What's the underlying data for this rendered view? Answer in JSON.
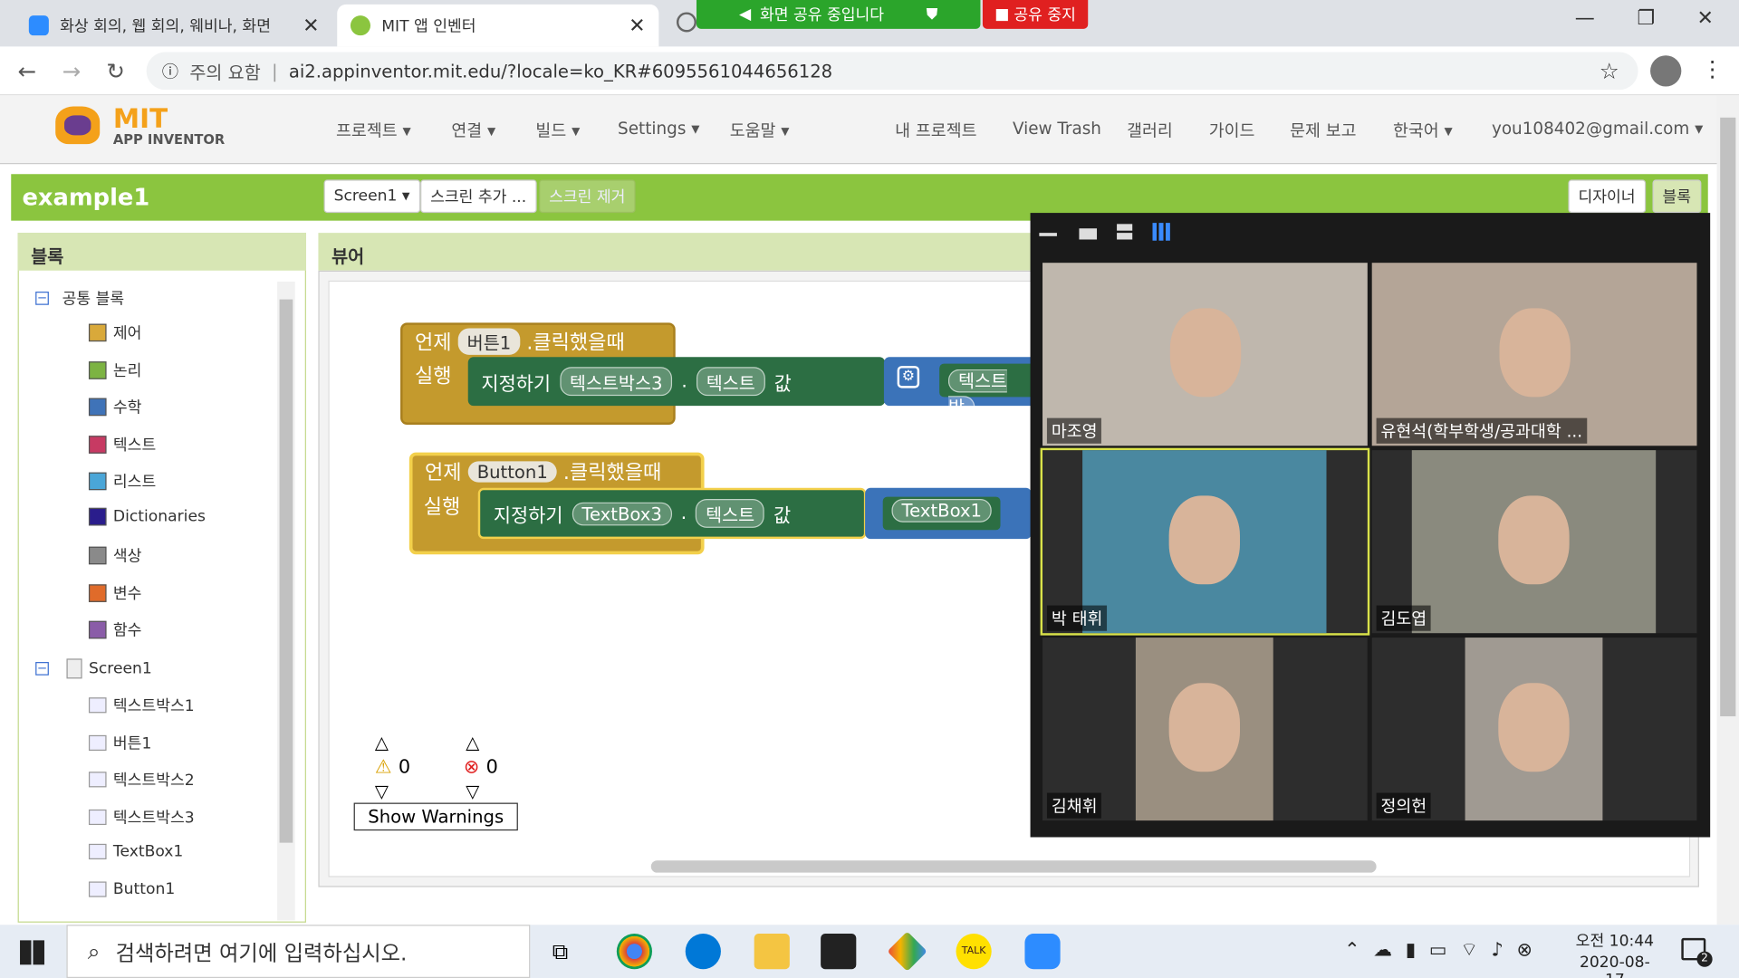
{
  "browser": {
    "tabs": [
      {
        "title": "화상 회의, 웹 회의, 웨비나, 화면"
      },
      {
        "title": "MIT 앱 인벤터"
      }
    ],
    "share_banner": "화면 공유 중입니다",
    "stop_share": "공유 중지",
    "address": {
      "security": "주의 요함",
      "url": "ai2.appinventor.mit.edu/?locale=ko_KR#6095561044656128"
    }
  },
  "app": {
    "logo_main": "MIT",
    "logo_sub": "APP INVENTOR",
    "menus": [
      "프로젝트 ▾",
      "연결 ▾",
      "빌드 ▾",
      "Settings ▾",
      "도움말 ▾"
    ],
    "right_links": [
      "내 프로젝트",
      "View Trash",
      "갤러리",
      "가이드",
      "문제 보고",
      "한국어 ▾",
      "you108402@gmail.com ▾"
    ],
    "project_name": "example1",
    "screen_select": "Screen1 ▾",
    "add_screen": "스크린 추가 ...",
    "remove_screen": "스크린 제거",
    "designer": "디자이너",
    "blocks_btn": "블록"
  },
  "blocks_panel": {
    "title": "블록",
    "builtin": "공통 블록",
    "categories": [
      {
        "label": "제어",
        "color": "#d9a93a"
      },
      {
        "label": "논리",
        "color": "#7cb342"
      },
      {
        "label": "수학",
        "color": "#3f73b8"
      },
      {
        "label": "텍스트",
        "color": "#c73a63"
      },
      {
        "label": "리스트",
        "color": "#4aa6d8"
      },
      {
        "label": "Dictionaries",
        "color": "#2a1d8c"
      },
      {
        "label": "색상",
        "color": "#8a8a8a"
      },
      {
        "label": "변수",
        "color": "#e06b2a"
      },
      {
        "label": "함수",
        "color": "#8a5ca8"
      }
    ],
    "screen": "Screen1",
    "components": [
      "텍스트박스1",
      "버튼1",
      "텍스트박스2",
      "텍스트박스3",
      "TextBox1",
      "Button1"
    ]
  },
  "viewer": {
    "title": "뷰어",
    "block1": {
      "when": "언제",
      "component": "버튼1",
      "event": ".클릭했을때",
      "do": "실행",
      "set": "지정하기",
      "target": "텍스트박스3",
      "dot": ".",
      "prop": "텍스트",
      "to": "값",
      "value": "텍스트박"
    },
    "block2": {
      "when": "언제",
      "component": "Button1",
      "event": ".클릭했을때",
      "do": "실행",
      "set": "지정하기",
      "target": "TextBox3",
      "dot": ".",
      "prop": "텍스트",
      "to": "값",
      "value": "TextBox1"
    },
    "warnings_count": "0",
    "errors_count": "0",
    "show_warnings": "Show Warnings"
  },
  "zoom": {
    "participants": [
      "마조영",
      "유현석(학부학생/공과대학 ...",
      "박 태휘",
      "김도엽",
      "김채휘",
      "정의헌"
    ]
  },
  "taskbar": {
    "search_placeholder": "검색하려면 여기에 입력하십시오.",
    "time": "오전 10:44",
    "date": "2020-08-17",
    "notif_count": "2"
  }
}
